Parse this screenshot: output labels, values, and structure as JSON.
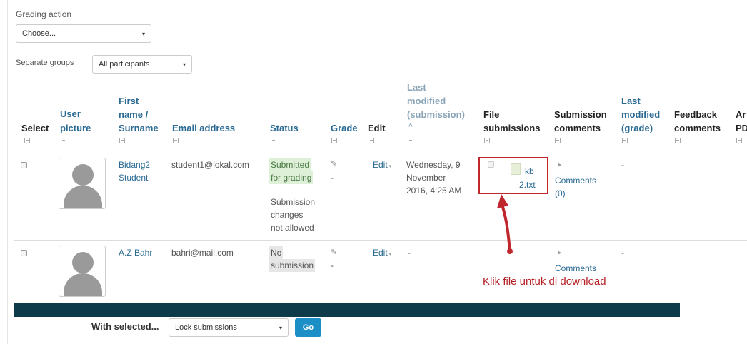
{
  "grading_action": {
    "label": "Grading action",
    "selected": "Choose..."
  },
  "separate_groups": {
    "label": "Separate groups",
    "selected": "All participants"
  },
  "table": {
    "headers": {
      "select": "Select",
      "user_picture_1": "User",
      "user_picture_2": "picture",
      "name_1": "First",
      "name_2": "name /",
      "name_3": "Surname",
      "email": "Email address",
      "status": "Status",
      "grade": "Grade",
      "edit": "Edit",
      "last_mod_1": "Last",
      "last_mod_2": "modified",
      "last_mod_3": "(submission)",
      "last_mod_sort": "^",
      "file_1": "File",
      "file_2": "submissions",
      "sub_comments_1": "Submission",
      "sub_comments_2": "comments",
      "last_grade_1": "Last",
      "last_grade_2": "modified",
      "last_grade_3": "(grade)",
      "feedback_1": "Feedback",
      "feedback_2": "comments",
      "annot_1": "Ar",
      "annot_2": "PD"
    },
    "rows": [
      {
        "name_1": "Bidang2",
        "name_2": "Student",
        "email": "student1@lokal.com",
        "status_1": "Submitted",
        "status_2": "for grading",
        "status_note_1": "Submission",
        "status_note_2": "changes",
        "status_note_3": "not allowed",
        "grade": "-",
        "edit": "Edit",
        "last_mod_1": "Wednesday, 9",
        "last_mod_2": "November",
        "last_mod_3": "2016, 4:25 AM",
        "file_1": "kb",
        "file_2": "2.txt",
        "comments_1": "Comments",
        "comments_2": "(0)",
        "last_grade": "-"
      },
      {
        "name_1": "A.Z Bahr",
        "email": "bahri@mail.com",
        "status_1": "No",
        "status_2": "submission",
        "grade": "-",
        "edit": "Edit",
        "last_mod_1": "-",
        "comments_1": "Comments",
        "last_grade": "-"
      }
    ]
  },
  "annotation": "Klik file untuk di download",
  "footer": {
    "with_selected": "With selected...",
    "bulk_action": "Lock submissions",
    "go": "Go"
  }
}
